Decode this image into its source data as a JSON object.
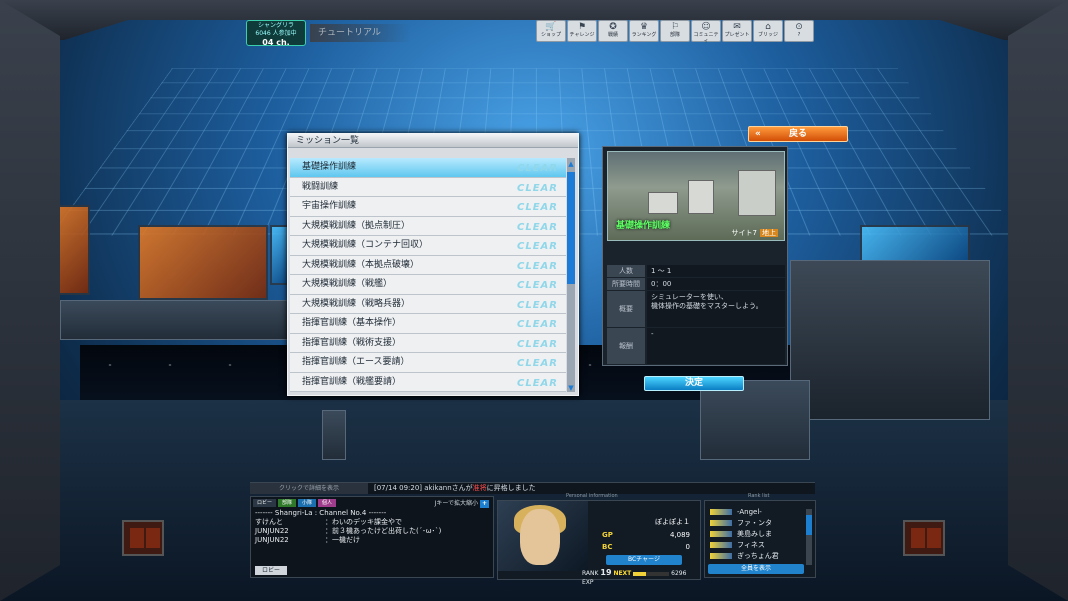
{
  "channel": {
    "server": "シャングリラ",
    "participants": "6046 人参加中",
    "channel": "04 ch."
  },
  "tutorial_label": "チュートリアル",
  "top_menu": [
    {
      "label": "ショップ",
      "icon": "cart-icon"
    },
    {
      "label": "チャレンジ",
      "icon": "flag-icon"
    },
    {
      "label": "戦績",
      "icon": "medal-icon"
    },
    {
      "label": "ランキング",
      "icon": "crown-icon"
    },
    {
      "label": "部隊",
      "icon": "squad-icon"
    },
    {
      "label": "コミュニティ",
      "icon": "community-icon"
    },
    {
      "label": "プレゼント",
      "icon": "gift-icon"
    },
    {
      "label": "ブリッジ",
      "icon": "bridge-icon"
    },
    {
      "label": "?",
      "icon": "help-icon"
    }
  ],
  "mission_list": {
    "title": "ミッション一覧",
    "clear_label": "CLEAR",
    "items": [
      "基礎操作訓練",
      "戦闘訓練",
      "宇宙操作訓練",
      "大規模戦訓練（拠点制圧）",
      "大規模戦訓練（コンテナ回収）",
      "大規模戦訓練（本拠点破壊）",
      "大規模戦訓練（戦艦）",
      "大規模戦訓練（戦略兵器）",
      "指揮官訓練（基本操作）",
      "指揮官訓練（戦術支援）",
      "指揮官訓練（エース要請）",
      "指揮官訓練（戦艦要請）"
    ],
    "selected_index": 0
  },
  "back_button": "戻る",
  "detail": {
    "map_name": "基礎操作訓練",
    "site": "サイト7",
    "terrain": "地上",
    "players_label": "人数",
    "players_value": "1 ～ 1",
    "time_label": "所要時間",
    "time_value": "0：00",
    "summary_label": "概要",
    "summary_value_1": "シミュレーターを使い、",
    "summary_value_2": "機体操作の基礎をマスターしよう。",
    "reward_label": "報酬",
    "reward_value": "-"
  },
  "decide_button": "決定",
  "bottom": {
    "click_detail": "クリックで詳細を表示",
    "news_prefix": "[07/14 09:20] akikannさんが",
    "news_highlight": "准将",
    "news_suffix": "に昇格しました",
    "chat_tabs": [
      {
        "label": "ロビー",
        "color": "#2b3744"
      },
      {
        "label": "部隊",
        "color": "#2f7a2a"
      },
      {
        "label": "小隊",
        "color": "#1c6fae"
      },
      {
        "label": "個人",
        "color": "#a03c8c"
      }
    ],
    "zoom_hint": "Jキーで拡大縮小",
    "zoom_symbol": "+",
    "chat_header": "------- Shangri-La : Channel No.4 -------",
    "chat_lines": [
      {
        "name": "すけんと",
        "msg": "：わいのデッキ課金やで"
      },
      {
        "name": "JUNJUN22",
        "msg": "：前３機あったけど出荷した(´･ω･`)"
      },
      {
        "name": "JUNJUN22",
        "msg": "：一機だけ"
      }
    ],
    "lobby_button": "ロビー"
  },
  "player": {
    "panel_title": "Personal information",
    "name": "ぽよぽよ１",
    "gp_label": "GP",
    "gp_value": "4,089",
    "bc_label": "BC",
    "bc_value": "0",
    "bc_charge": "BCチャージ",
    "rank_label": "RANK",
    "rank_value": "19",
    "next_label": "NEXT",
    "exp_value": "6296",
    "exp_unit": "EXP",
    "exp_progress": 0.35
  },
  "ranklist": {
    "title": "Rank list",
    "entries": [
      "-Angel-",
      "ファ・ンタ",
      "美島みしま",
      "フィネス",
      "ぎっちょん君"
    ],
    "show_all": "全員を表示"
  }
}
